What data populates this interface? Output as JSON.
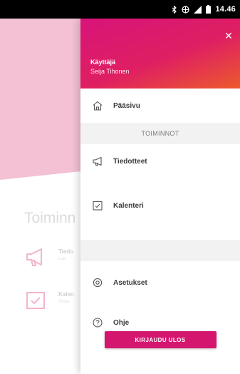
{
  "status_bar": {
    "time": "14.46"
  },
  "background_screen": {
    "section_title": "Toiminn",
    "items": [
      {
        "title": "Tiedo",
        "subtitle": "Lue"
      },
      {
        "title": "Kalen",
        "subtitle": "Selaa"
      }
    ]
  },
  "drawer": {
    "user_role": "Käyttäjä",
    "user_name": "Seija Tihonen",
    "close_icon": "close-icon",
    "items": {
      "home": {
        "label": "Pääsivu",
        "icon": "home-icon"
      },
      "section": "TOIMINNOT",
      "announcements": {
        "label": "Tiedotteet",
        "icon": "megaphone-icon"
      },
      "calendar": {
        "label": "Kalenteri",
        "icon": "calendar-check-icon"
      },
      "settings": {
        "label": "Asetukset",
        "icon": "gear-icon"
      },
      "help": {
        "label": "Ohje",
        "icon": "help-icon"
      }
    },
    "logout_label": "KIRJAUDU ULOS"
  },
  "colors": {
    "accent": "#d5166f",
    "header_gradient_end": "#ec5a2c",
    "bg_hero": "#f2b8cf"
  }
}
